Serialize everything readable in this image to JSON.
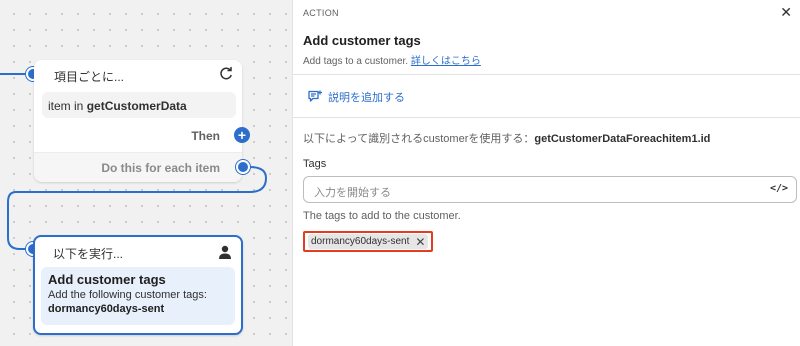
{
  "canvas": {
    "loop_node": {
      "header": "項目ごとに...",
      "item_prefix": "item in",
      "item_value": "getCustomerData",
      "then_label": "Then",
      "each_label": "Do this for each item"
    },
    "action_node": {
      "header": "以下を実行...",
      "title": "Add customer tags",
      "description": "Add the following customer tags:",
      "tag": "dormancy60days-sent"
    }
  },
  "panel": {
    "eyebrow": "ACTION",
    "close_icon": "✕",
    "title": "Add customer tags",
    "subtitle": "Add tags to a customer.",
    "learn_more": "詳しくはこちら",
    "add_description": "説明を追加する",
    "identified_prefix": "以下によって識別されるcustomerを使用する：",
    "identified_value": "getCustomerDataForeachitem1.id",
    "tags_label": "Tags",
    "tags_placeholder": "入力を開始する",
    "code_toggle": "</>",
    "tags_help": "The tags to add to the customer.",
    "tag_chip": "dormancy60days-sent",
    "tag_remove": "✕"
  },
  "colors": {
    "accent": "#2c6ecb",
    "highlight": "#e53b1f"
  }
}
